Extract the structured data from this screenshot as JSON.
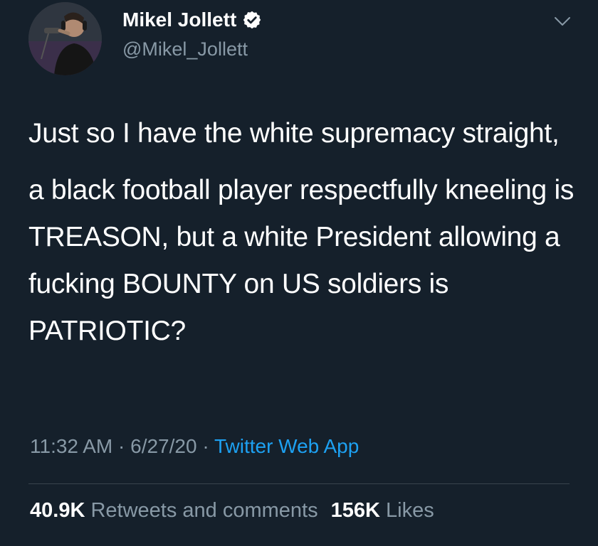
{
  "author": {
    "display_name": "Mikel Jollett",
    "handle": "@Mikel_Jollett",
    "verified": true
  },
  "tweet": {
    "paragraphs": [
      "Just so I have the white supremacy straight,",
      "a black football player respectfully kneeling is TREASON, but a white President allowing a fucking BOUNTY on US soldiers is PATRIOTIC?"
    ]
  },
  "meta": {
    "time": "11:32 AM",
    "separator": " · ",
    "date": "6/27/20",
    "source": "Twitter Web App"
  },
  "stats": {
    "retweets_count": "40.9K",
    "retweets_label": "Retweets and comments",
    "likes_count": "156K",
    "likes_label": "Likes"
  },
  "icons": {
    "verified": "verified-badge-icon",
    "more": "chevron-down-icon"
  },
  "colors": {
    "background": "#15202b",
    "secondary_text": "#8899a6",
    "link": "#1da1f2",
    "divider": "#38444d"
  }
}
